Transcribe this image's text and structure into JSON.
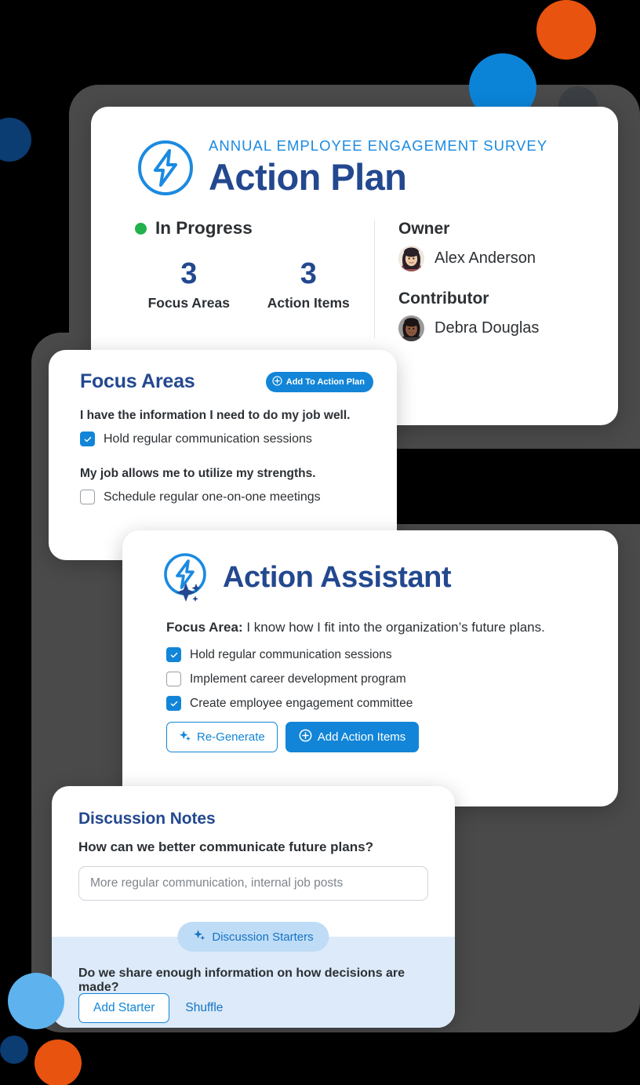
{
  "decor": {
    "orange": "#e8530f",
    "blue": "#0b84d8",
    "light_blue": "#5eb3ee",
    "navy": "#0b3c72",
    "dark_gray": "#4a4a4a"
  },
  "action_plan": {
    "eyebrow": "ANNUAL EMPLOYEE ENGAGEMENT SURVEY",
    "title": "Action Plan",
    "logo_icon": "lightning-bolt-circle-icon",
    "status": {
      "label": "In Progress",
      "color": "#22b14c"
    },
    "stats": [
      {
        "value": "3",
        "label": "Focus Areas"
      },
      {
        "value": "3",
        "label": "Action Items"
      }
    ],
    "people": [
      {
        "role": "Owner",
        "name": "Alex Anderson"
      },
      {
        "role": "Contributor",
        "name": "Debra Douglas"
      }
    ],
    "accent_color": "#23488f"
  },
  "focus_areas": {
    "title": "Focus Areas",
    "add_button": "Add To Action Plan",
    "add_button_icon": "plus-circle-icon",
    "groups": [
      {
        "question": "I have the information I need to do my job well.",
        "items": [
          {
            "label": "Hold regular communication sessions",
            "checked": true
          }
        ]
      },
      {
        "question": "My job allows me to utilize my strengths.",
        "items": [
          {
            "label": "Schedule regular one-on-one meetings",
            "checked": false
          }
        ]
      }
    ]
  },
  "action_assistant": {
    "title": "Action Assistant",
    "logo_icon": "lightning-bolt-sparkle-icon",
    "focus_prefix": "Focus Area:",
    "focus_text": " I know how I fit into the organization’s future plans.",
    "items": [
      {
        "label": "Hold regular communication sessions",
        "checked": true
      },
      {
        "label": "Implement career development program",
        "checked": false
      },
      {
        "label": "Create employee engagement committee",
        "checked": true
      }
    ],
    "regenerate_button": "Re-Generate",
    "regenerate_icon": "sparkle-icon",
    "add_items_button": "Add Action Items",
    "add_items_icon": "plus-circle-icon"
  },
  "discussion_notes": {
    "title": "Discussion Notes",
    "question": "How can we better communicate future plans?",
    "note_placeholder": "More regular communication, internal job posts",
    "note_value": "",
    "starters_chip": "Discussion Starters",
    "starters_chip_icon": "sparkle-icon",
    "starter_text": "Do we share enough information on how decisions are made?",
    "add_starter_button": "Add Starter",
    "shuffle_button": "Shuffle",
    "band_color": "#dceaf9"
  }
}
